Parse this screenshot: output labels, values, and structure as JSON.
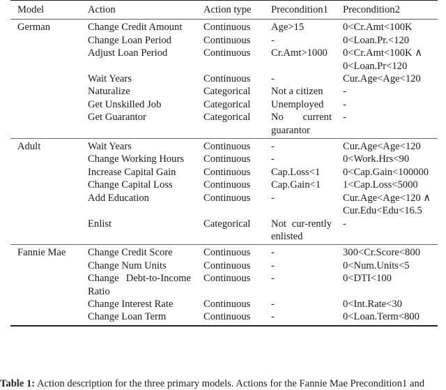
{
  "table": {
    "headers": [
      "Model",
      "Action",
      "Action type",
      "Precondition1",
      "Precondition2"
    ],
    "groups": [
      {
        "model": "German",
        "rows": [
          {
            "action": "Change Credit Amount",
            "type": "Continuous",
            "pre1": "Age>15",
            "pre2": "0<Cr.Amt<100K"
          },
          {
            "action": "Change Loan Period",
            "type": "Continuous",
            "pre1": "-",
            "pre2": "0<Loan.Pr.<120"
          },
          {
            "action": "Adjust Loan Period",
            "type": "Continuous",
            "pre1": "Cr.Amt>1000",
            "pre2": "0<Cr.Amt<100K ∧ 0<Loan.Pr<120"
          },
          {
            "action": "Wait Years",
            "type": "Continuous",
            "pre1": "-",
            "pre2": "Cur.Age<Age<120"
          },
          {
            "action": "Naturalize",
            "type": "Categorical",
            "pre1": "Not a citizen",
            "pre2": "-"
          },
          {
            "action": "Get Unskilled Job",
            "type": "Categorical",
            "pre1": "Unemployed",
            "pre2": "-"
          },
          {
            "action": "Get Guarantor",
            "type": "Categorical",
            "pre1": "No current guarantor",
            "pre2": "-"
          }
        ]
      },
      {
        "model": "Adult",
        "rows": [
          {
            "action": "Wait Years",
            "type": "Continuous",
            "pre1": "-",
            "pre2": "Cur.Age<Age<120"
          },
          {
            "action": "Change Working Hours",
            "type": "Continuous",
            "pre1": "-",
            "pre2": "0<Work.Hrs<90"
          },
          {
            "action": "Increase Capital Gain",
            "type": "Continuous",
            "pre1": "Cap.Loss<1",
            "pre2": "0<Cap.Gain<100000"
          },
          {
            "action": "Change Capital Loss",
            "type": "Continuous",
            "pre1": "Cap.Gain<1",
            "pre2": "1<Cap.Loss<5000"
          },
          {
            "action": "Add Education",
            "type": "Continuous",
            "pre1": "-",
            "pre2": "Cur.Age<Age<120 ∧ Cur.Edu<Edu<16.5"
          },
          {
            "action": "Enlist",
            "type": "Categorical",
            "pre1": "Not cur-rently enlisted",
            "pre2": "-"
          }
        ]
      },
      {
        "model": "Fannie Mae",
        "rows": [
          {
            "action": "Change Credit Score",
            "type": "Continuous",
            "pre1": "-",
            "pre2": "300<Cr.Score<800"
          },
          {
            "action": "Change Num Units",
            "type": "Continuous",
            "pre1": "-",
            "pre2": "0<Num.Units<5"
          },
          {
            "action": "Change Debt-to-Income Ratio",
            "type": "Continuous",
            "pre1": "-",
            "pre2": "0<DTI<100"
          },
          {
            "action": "Change Interest Rate",
            "type": "Continuous",
            "pre1": "-",
            "pre2": "0<Int.Rate<30"
          },
          {
            "action": "Change Loan Term",
            "type": "Continuous",
            "pre1": "-",
            "pre2": "0<Loan.Term<800"
          }
        ]
      }
    ]
  },
  "caption": {
    "label": "Table 1:",
    "text": "Action description for the three primary models. Actions for the Fannie Mae Precondition1 and"
  }
}
